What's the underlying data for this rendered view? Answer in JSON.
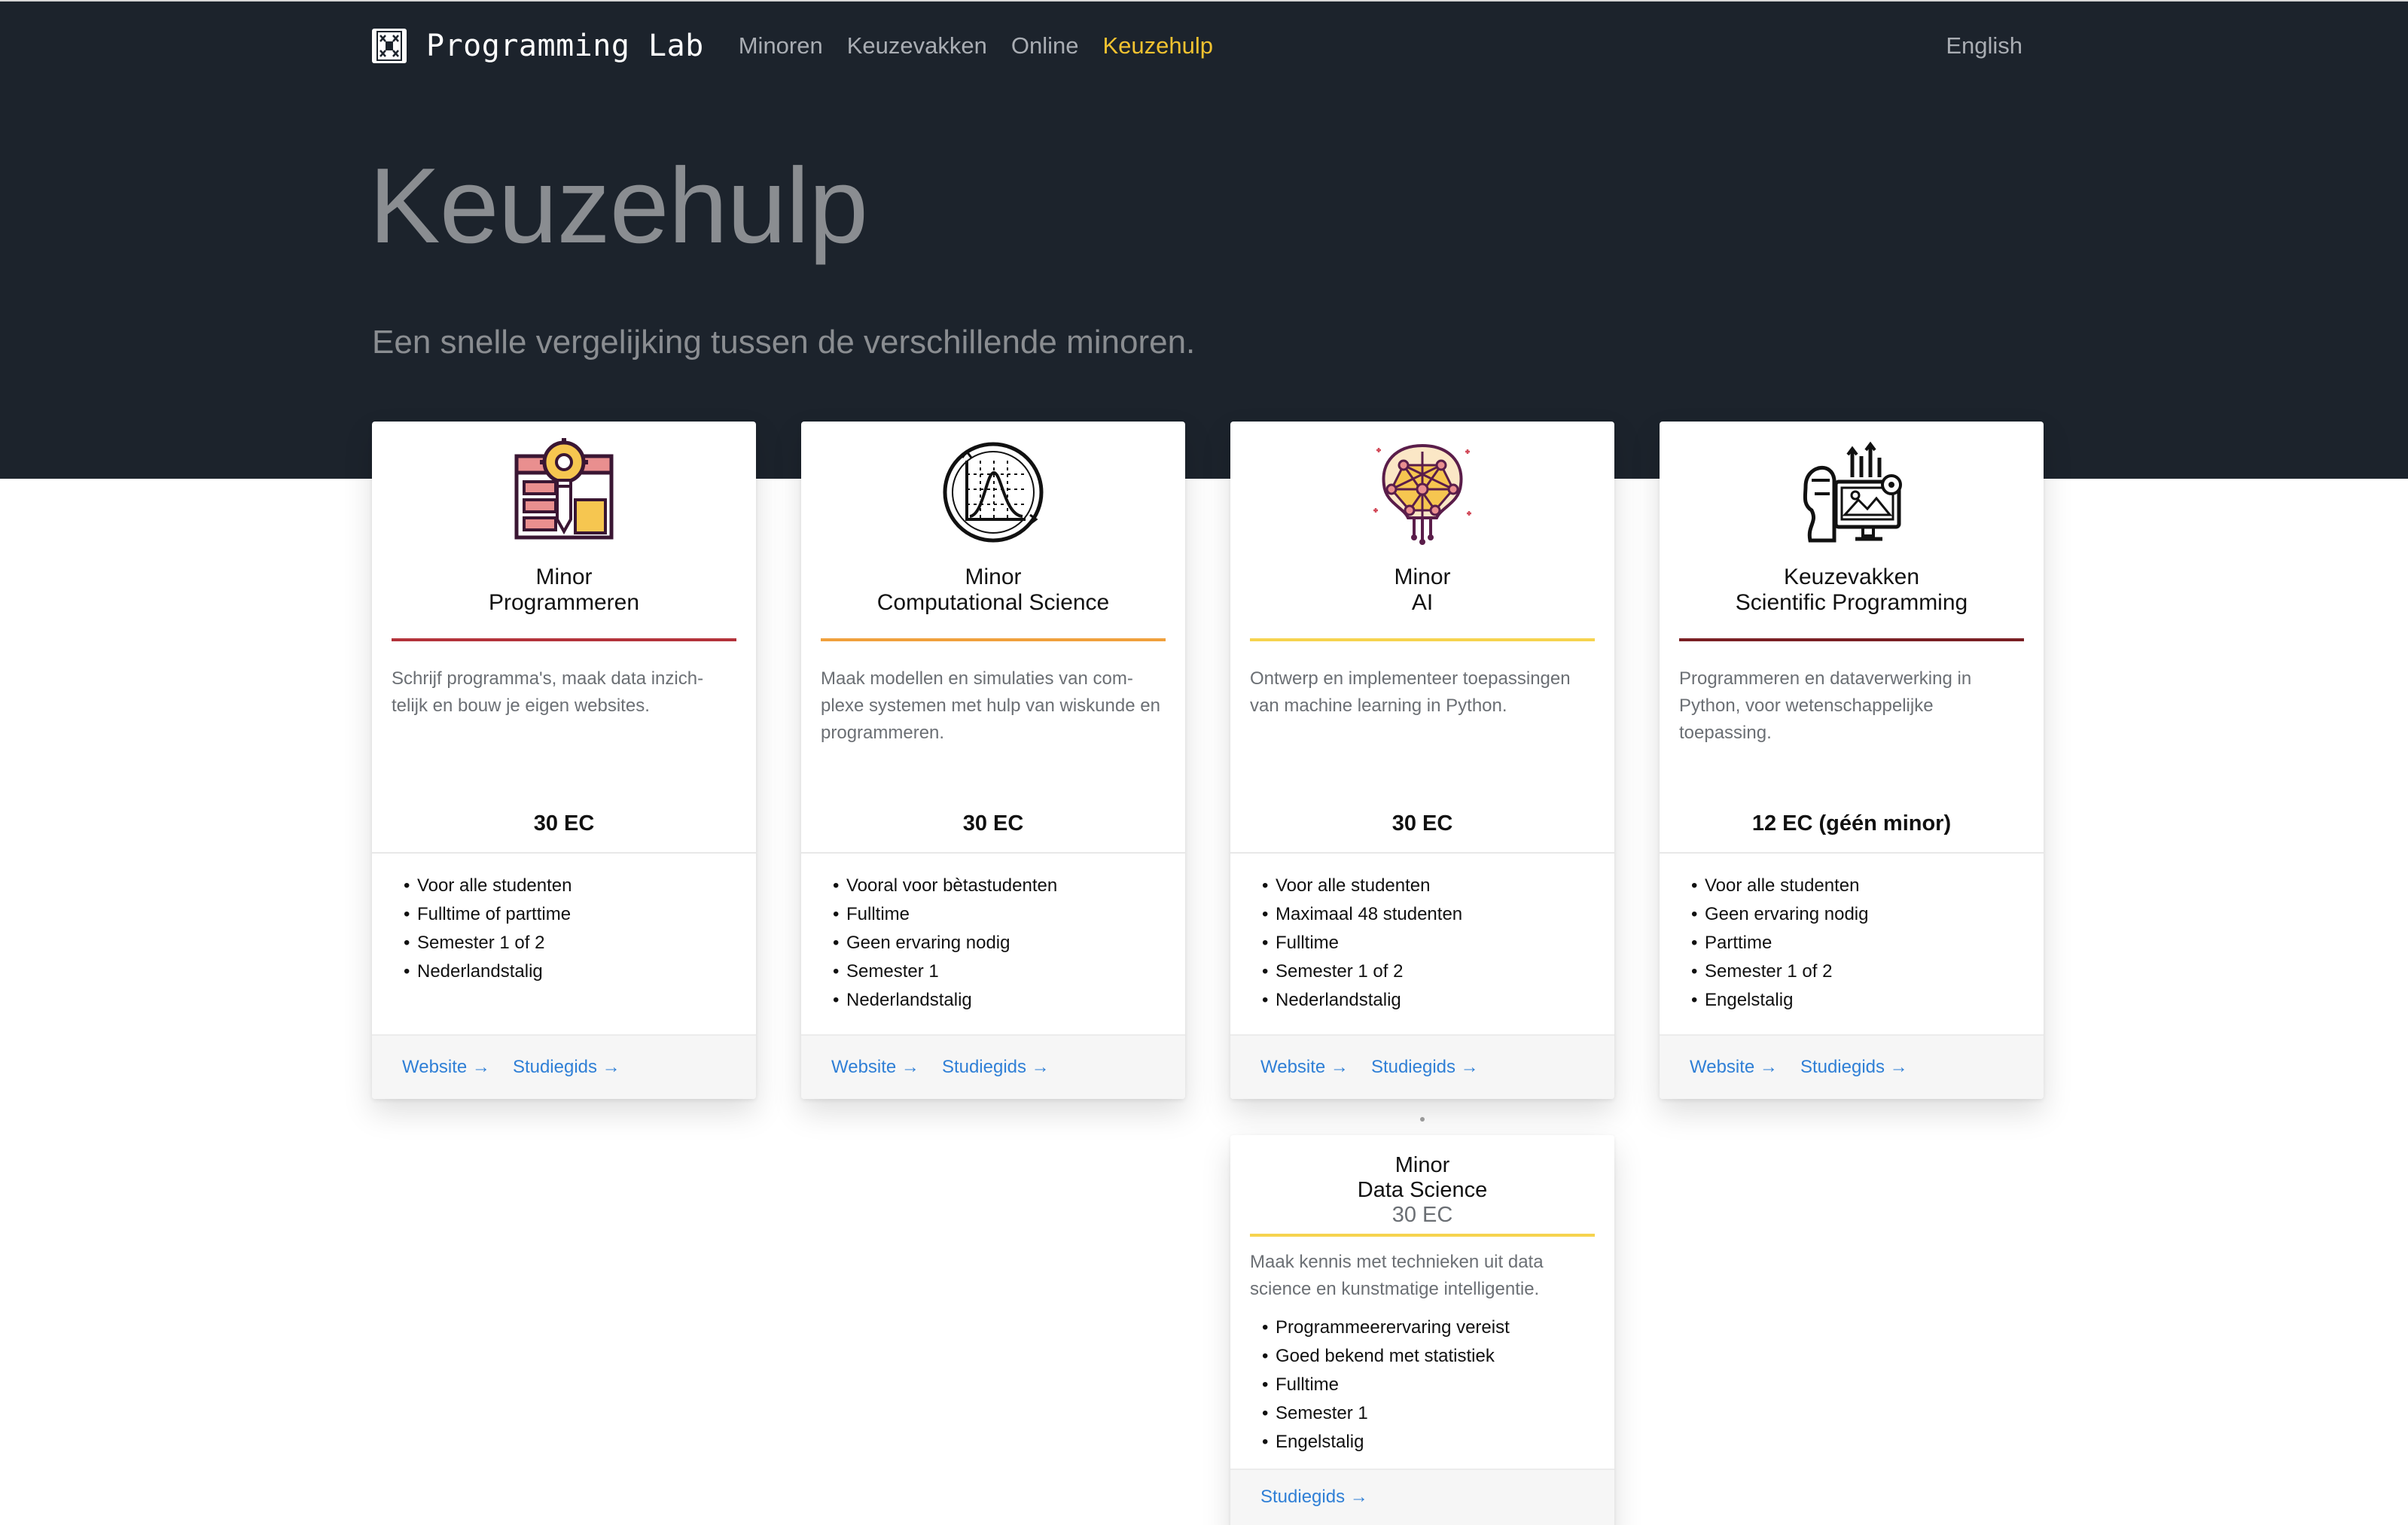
{
  "nav": {
    "brand": "Programming Lab",
    "links": [
      {
        "label": "Minoren",
        "active": false
      },
      {
        "label": "Keuzevakken",
        "active": false
      },
      {
        "label": "Online",
        "active": false
      },
      {
        "label": "Keuzehulp",
        "active": true
      }
    ],
    "language": "English",
    "active_color": "#f2c230"
  },
  "hero": {
    "title": "Keuzehulp",
    "subtitle": "Een snelle vergelijking tussen de verschillende minoren."
  },
  "cards": [
    {
      "type": "Minor",
      "title": "Programmeren",
      "icon": "coding-tools-icon",
      "accent": "#b3323a",
      "description": "Schrijf programma's, maak data inzich-telijk en bouw je eigen websites.",
      "ec": "30 EC",
      "features": [
        "Voor alle studenten",
        "Fulltime of parttime",
        "Semester 1 of 2",
        "Nederlandstalig"
      ],
      "links": [
        "Website →",
        "Studiegids →"
      ]
    },
    {
      "type": "Minor",
      "title": "Computational Science",
      "icon": "distribution-graph-icon",
      "accent": "#f0a03c",
      "description": "Maak modellen en simulaties van com-plexe systemen met hulp van wiskunde en programmeren.",
      "ec": "30 EC",
      "features": [
        "Vooral voor bètastudenten",
        "Fulltime",
        "Geen ervaring nodig",
        "Semester 1",
        "Nederlandstalig"
      ],
      "links": [
        "Website →",
        "Studiegids →"
      ]
    },
    {
      "type": "Minor",
      "title": "AI",
      "icon": "neural-brain-icon",
      "accent": "#f6d34e",
      "description": "Ontwerp en implementeer toepassingen van machine learning in Python.",
      "ec": "30 EC",
      "features": [
        "Voor alle studenten",
        "Maximaal 48 studenten",
        "Fulltime",
        "Semester 1 of 2",
        "Nederlandstalig"
      ],
      "links": [
        "Website →",
        "Studiegids →"
      ]
    },
    {
      "type": "Keuzevakken",
      "title": "Scientific Programming",
      "icon": "scientist-analytics-icon",
      "accent": "#7a1f23",
      "description": "Programmeren en dataverwerking in Python, voor wetenschappelijke toepassing.",
      "ec_main": "12 EC",
      "ec_note": "(géén minor)",
      "features": [
        "Voor alle studenten",
        "Geen ervaring nodig",
        "Parttime",
        "Semester 1 of 2",
        "Engelstalig"
      ],
      "links": [
        "Website →",
        "Studiegids →"
      ]
    }
  ],
  "data_science": {
    "type": "Minor",
    "title": "Data Science",
    "ec": "30 EC",
    "accent": "#f6d34e",
    "description": "Maak kennis met technieken uit data science en kunstmatige intelligentie.",
    "features": [
      "Programmeerervaring vereist",
      "Goed bekend met statistiek",
      "Fulltime",
      "Semester 1",
      "Engelstalig"
    ],
    "link": "Studiegids →"
  }
}
